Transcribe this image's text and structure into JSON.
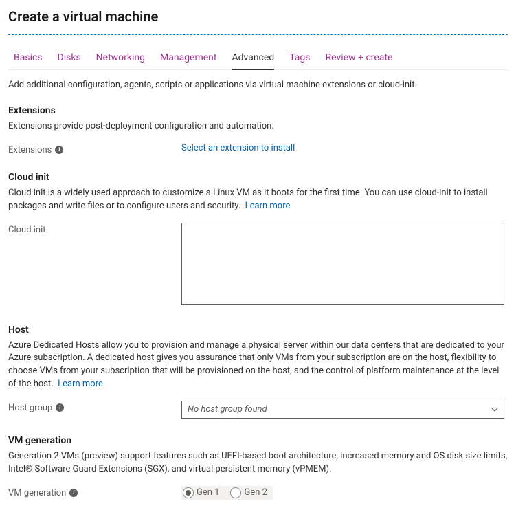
{
  "page_title": "Create a virtual machine",
  "tabs": [
    {
      "label": "Basics"
    },
    {
      "label": "Disks"
    },
    {
      "label": "Networking"
    },
    {
      "label": "Management"
    },
    {
      "label": "Advanced",
      "active": true
    },
    {
      "label": "Tags"
    },
    {
      "label": "Review + create"
    }
  ],
  "intro": "Add additional configuration, agents, scripts or applications via virtual machine extensions or cloud-init.",
  "extensions": {
    "title": "Extensions",
    "desc": "Extensions provide post-deployment configuration and automation.",
    "field_label": "Extensions",
    "select_link": "Select an extension to install"
  },
  "cloud_init": {
    "title": "Cloud init",
    "desc": "Cloud init is a widely used approach to customize a Linux VM as it boots for the first time. You can use cloud-init to install packages and write files or to configure users and security.",
    "learn_more": "Learn more",
    "field_label": "Cloud init",
    "value": ""
  },
  "host": {
    "title": "Host",
    "desc": "Azure Dedicated Hosts allow you to provision and manage a physical server within our data centers that are dedicated to your Azure subscription. A dedicated host gives you assurance that only VMs from your subscription are on the host, flexibility to choose VMs from your subscription that will be provisioned on the host, and the control of platform maintenance at the level of the host.",
    "learn_more": "Learn more",
    "field_label": "Host group",
    "selected": "No host group found"
  },
  "vm_generation": {
    "title": "VM generation",
    "desc": "Generation 2 VMs (preview) support features such as UEFI-based boot architecture, increased memory and OS disk size limits, Intel® Software Guard Extensions (SGX), and virtual persistent memory (vPMEM).",
    "field_label": "VM generation",
    "options": [
      {
        "label": "Gen 1",
        "checked": true
      },
      {
        "label": "Gen 2",
        "checked": false
      }
    ]
  }
}
